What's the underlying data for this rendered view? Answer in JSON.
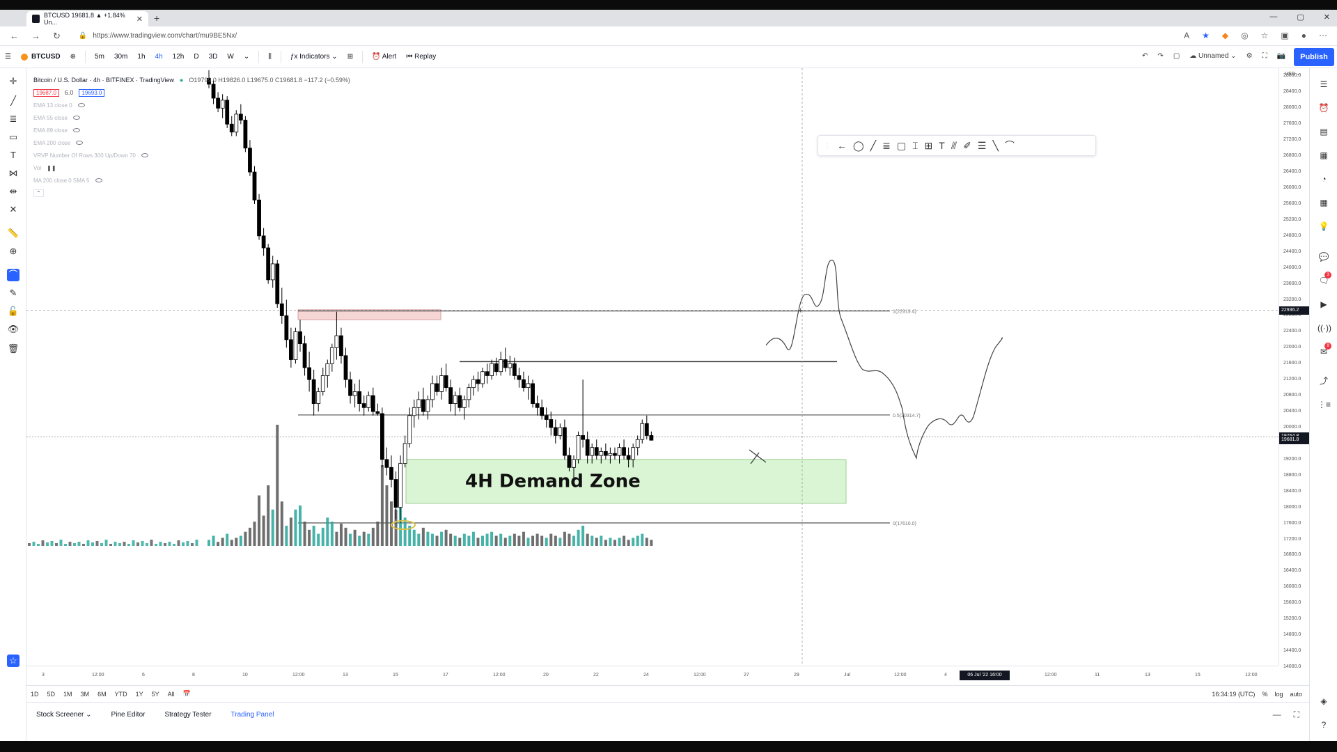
{
  "browser": {
    "tab_title": "BTCUSD 19681.8 ▲ +1.84% Un...",
    "url": "https://www.tradingview.com/chart/mu9BE5Nx/"
  },
  "toolbar": {
    "symbol": "BTCUSD",
    "intervals": [
      "5m",
      "30m",
      "1h",
      "4h",
      "12h",
      "D",
      "3D",
      "W"
    ],
    "indicators_label": "Indicators",
    "alert_label": "Alert",
    "replay_label": "Replay",
    "layout_name": "Unnamed",
    "publish_label": "Publish"
  },
  "legend": {
    "title": "Bitcoin / U.S. Dollar · 4h · BITFINEX · TradingView",
    "ohlc": "O19799.0 H19826.0 L19675.0 C19681.8 −117.2 (−0.59%)",
    "bid": "19687.0",
    "spread": "6.0",
    "ask": "19693.0",
    "indicators": [
      "EMA 13 close 0",
      "EMA 55 close",
      "EMA 89 close",
      "EMA 200 close",
      "VRVP Number Of Rows 300 Up/Down 70",
      "Vol",
      "MA 200 close 0 SMA 5"
    ]
  },
  "chart_data": {
    "type": "candlestick",
    "symbol": "BTCUSD",
    "timeframe": "4h",
    "exchange": "BITFINEX",
    "ylim": [
      14000,
      29000
    ],
    "price_ticks": [
      29000,
      28800,
      28400,
      28000,
      27600,
      27200,
      26800,
      26400,
      26000,
      25600,
      25200,
      24800,
      24400,
      24000,
      23600,
      23200,
      22800,
      22400,
      22000,
      21600,
      21200,
      20800,
      20400,
      20000,
      19600,
      19200,
      18800,
      18400,
      18000,
      17600,
      17200,
      16800,
      16400,
      16000,
      15600,
      15200,
      14800,
      14400,
      14000
    ],
    "time_ticks": [
      "3",
      "12:00",
      "6",
      "8",
      "10",
      "12:00",
      "13",
      "15",
      "17",
      "12:00",
      "20",
      "22",
      "24",
      "12:00",
      "27",
      "29",
      "Jul",
      "12:00",
      "4",
      "8",
      "12:00",
      "11",
      "13",
      "15",
      "12:00"
    ],
    "cursor_time": "06 Jul '22 16:00",
    "cursor_price": "22936.2",
    "last_price": "19681.8",
    "last_price_extra": "19764.8",
    "fib_levels": [
      {
        "label": "1(22919.4)",
        "value": 22919.4
      },
      {
        "label": "0.5(20314.7)",
        "value": 20314.7
      },
      {
        "label": "0(17610.0)",
        "value": 17610.0
      }
    ],
    "annotations": [
      "4H Demand Zone"
    ],
    "demand_zone": [
      18100,
      19200
    ],
    "supply_zone": [
      22700,
      22950
    ],
    "range_high": 21650,
    "colors": {
      "up": "#ffffff",
      "down": "#000000",
      "volume_up": "#26a69a",
      "volume_down": "#555555",
      "zone": "#d9f5d3",
      "supply": "#f6d5d5"
    },
    "candles": [
      [
        28750,
        28950,
        28500,
        28600
      ],
      [
        28600,
        28700,
        28100,
        28250
      ],
      [
        28250,
        28400,
        27900,
        28000
      ],
      [
        28000,
        28350,
        27750,
        28200
      ],
      [
        28200,
        28300,
        27500,
        27600
      ],
      [
        27600,
        27800,
        27300,
        27400
      ],
      [
        27400,
        27950,
        27300,
        27850
      ],
      [
        27850,
        28100,
        27600,
        27700
      ],
      [
        27700,
        27800,
        26900,
        27000
      ],
      [
        27000,
        27200,
        26300,
        26400
      ],
      [
        26400,
        26550,
        25600,
        25700
      ],
      [
        25700,
        25850,
        24700,
        24800
      ],
      [
        24800,
        25000,
        24300,
        24500
      ],
      [
        24500,
        24600,
        23600,
        23700
      ],
      [
        23700,
        24300,
        23500,
        24100
      ],
      [
        24100,
        24200,
        23000,
        23100
      ],
      [
        23100,
        23500,
        22600,
        22800
      ],
      [
        22800,
        23200,
        22000,
        22200
      ],
      [
        22200,
        22500,
        21500,
        21700
      ],
      [
        21700,
        22500,
        21600,
        22400
      ],
      [
        22400,
        22700,
        21900,
        22100
      ],
      [
        22100,
        22300,
        21300,
        21500
      ],
      [
        21500,
        21900,
        20900,
        21200
      ],
      [
        21200,
        21450,
        20300,
        20600
      ],
      [
        20600,
        21000,
        20400,
        20900
      ],
      [
        20900,
        21500,
        20800,
        21300
      ],
      [
        21300,
        21700,
        21000,
        21600
      ],
      [
        21600,
        22100,
        21400,
        22000
      ],
      [
        22000,
        22900,
        21700,
        22300
      ],
      [
        22300,
        22500,
        21600,
        21800
      ],
      [
        21800,
        22000,
        21000,
        21200
      ],
      [
        21200,
        21400,
        20600,
        20800
      ],
      [
        20800,
        21100,
        20500,
        20900
      ],
      [
        20900,
        21200,
        20400,
        20600
      ],
      [
        20600,
        20800,
        20300,
        20500
      ],
      [
        20500,
        20900,
        20400,
        20800
      ],
      [
        20800,
        21000,
        20300,
        20400
      ],
      [
        20400,
        20600,
        20300,
        20350
      ],
      [
        20350,
        20500,
        19000,
        19200
      ],
      [
        19200,
        19500,
        18800,
        19000
      ],
      [
        19000,
        19300,
        18500,
        18700
      ],
      [
        18700,
        18900,
        17700,
        18000
      ],
      [
        18000,
        19300,
        17610,
        19100
      ],
      [
        19100,
        19800,
        19000,
        19600
      ],
      [
        19600,
        20500,
        19500,
        20300
      ],
      [
        20300,
        20700,
        20000,
        20500
      ],
      [
        20500,
        20900,
        20200,
        20700
      ],
      [
        20700,
        21000,
        20300,
        20400
      ],
      [
        20400,
        20800,
        20200,
        20700
      ],
      [
        20700,
        21300,
        20500,
        21100
      ],
      [
        21100,
        21300,
        20800,
        20900
      ],
      [
        20900,
        21500,
        20700,
        21300
      ],
      [
        21300,
        21600,
        20900,
        21000
      ],
      [
        21000,
        21200,
        20400,
        20600
      ],
      [
        20600,
        20900,
        20300,
        20800
      ],
      [
        20800,
        21000,
        20400,
        20500
      ],
      [
        20500,
        20800,
        20200,
        20700
      ],
      [
        20700,
        21100,
        20500,
        21000
      ],
      [
        21000,
        21300,
        20800,
        21200
      ],
      [
        21200,
        21400,
        20900,
        21100
      ],
      [
        21100,
        21500,
        21000,
        21400
      ],
      [
        21400,
        21600,
        21100,
        21300
      ],
      [
        21300,
        21700,
        21200,
        21600
      ],
      [
        21600,
        21750,
        21300,
        21400
      ],
      [
        21400,
        21900,
        21300,
        21700
      ],
      [
        21700,
        22000,
        21400,
        21500
      ],
      [
        21500,
        21800,
        21300,
        21600
      ],
      [
        21600,
        21750,
        21200,
        21300
      ],
      [
        21300,
        21500,
        21000,
        21200
      ],
      [
        21200,
        21400,
        20900,
        21000
      ],
      [
        21000,
        21300,
        20700,
        21100
      ],
      [
        21100,
        21200,
        20500,
        20600
      ],
      [
        20600,
        20800,
        20300,
        20500
      ],
      [
        20500,
        20700,
        20200,
        20300
      ],
      [
        20300,
        20500,
        20000,
        20200
      ],
      [
        20200,
        20400,
        19800,
        20000
      ],
      [
        20000,
        20200,
        19600,
        19800
      ],
      [
        19800,
        20100,
        19700,
        20000
      ],
      [
        20000,
        20200,
        19200,
        19300
      ],
      [
        19300,
        19500,
        18900,
        19000
      ],
      [
        19000,
        19300,
        18700,
        19200
      ],
      [
        19200,
        19900,
        19100,
        19800
      ],
      [
        19800,
        21200,
        19500,
        19700
      ],
      [
        19700,
        19900,
        19100,
        19300
      ],
      [
        19300,
        19600,
        19100,
        19500
      ],
      [
        19500,
        19700,
        19200,
        19300
      ],
      [
        19300,
        19500,
        19100,
        19400
      ],
      [
        19400,
        19600,
        19200,
        19300
      ],
      [
        19300,
        19500,
        19100,
        19350
      ],
      [
        19350,
        19500,
        19200,
        19300
      ],
      [
        19300,
        19600,
        19100,
        19500
      ],
      [
        19500,
        19700,
        19200,
        19300
      ],
      [
        19300,
        19500,
        19000,
        19200
      ],
      [
        19200,
        19600,
        19000,
        19500
      ],
      [
        19500,
        19800,
        19300,
        19700
      ],
      [
        19700,
        20200,
        19600,
        20100
      ],
      [
        20100,
        20300,
        19700,
        19800
      ],
      [
        19800,
        19900,
        19675,
        19682
      ]
    ],
    "volumes": [
      [
        3,
        1
      ],
      [
        5,
        1
      ],
      [
        2,
        0
      ],
      [
        4,
        0
      ],
      [
        6,
        1
      ],
      [
        3,
        0
      ],
      [
        4,
        0
      ],
      [
        5,
        1
      ],
      [
        7,
        0
      ],
      [
        9,
        0
      ],
      [
        12,
        0
      ],
      [
        25,
        0
      ],
      [
        15,
        0
      ],
      [
        30,
        0
      ],
      [
        18,
        1
      ],
      [
        60,
        0
      ],
      [
        22,
        0
      ],
      [
        10,
        1
      ],
      [
        14,
        0
      ],
      [
        18,
        1
      ],
      [
        20,
        1
      ],
      [
        12,
        0
      ],
      [
        8,
        0
      ],
      [
        10,
        1
      ],
      [
        6,
        1
      ],
      [
        9,
        1
      ],
      [
        14,
        1
      ],
      [
        12,
        1
      ],
      [
        7,
        0
      ],
      [
        11,
        0
      ],
      [
        9,
        0
      ],
      [
        6,
        1
      ],
      [
        8,
        0
      ],
      [
        5,
        1
      ],
      [
        7,
        0
      ],
      [
        6,
        1
      ],
      [
        9,
        0
      ],
      [
        12,
        0
      ],
      [
        40,
        0
      ],
      [
        30,
        0
      ],
      [
        22,
        0
      ],
      [
        18,
        0
      ],
      [
        26,
        1
      ],
      [
        14,
        1
      ],
      [
        10,
        1
      ],
      [
        8,
        1
      ],
      [
        6,
        1
      ],
      [
        9,
        0
      ],
      [
        7,
        1
      ],
      [
        6,
        1
      ],
      [
        5,
        0
      ],
      [
        7,
        1
      ],
      [
        8,
        0
      ],
      [
        6,
        0
      ],
      [
        5,
        1
      ],
      [
        4,
        0
      ],
      [
        6,
        1
      ],
      [
        5,
        1
      ],
      [
        7,
        1
      ],
      [
        4,
        0
      ],
      [
        5,
        1
      ],
      [
        6,
        1
      ],
      [
        7,
        1
      ],
      [
        5,
        0
      ],
      [
        6,
        1
      ],
      [
        4,
        0
      ],
      [
        5,
        1
      ],
      [
        6,
        0
      ],
      [
        5,
        0
      ],
      [
        7,
        0
      ],
      [
        4,
        1
      ],
      [
        5,
        0
      ],
      [
        6,
        0
      ],
      [
        5,
        0
      ],
      [
        4,
        1
      ],
      [
        6,
        0
      ],
      [
        5,
        0
      ],
      [
        4,
        1
      ],
      [
        7,
        0
      ],
      [
        6,
        0
      ],
      [
        5,
        1
      ],
      [
        8,
        1
      ],
      [
        10,
        1
      ],
      [
        6,
        0
      ],
      [
        5,
        1
      ],
      [
        4,
        0
      ],
      [
        5,
        1
      ],
      [
        3,
        0
      ],
      [
        4,
        1
      ],
      [
        3,
        0
      ],
      [
        4,
        1
      ],
      [
        5,
        0
      ],
      [
        3,
        0
      ],
      [
        4,
        1
      ],
      [
        5,
        1
      ],
      [
        6,
        1
      ],
      [
        4,
        0
      ],
      [
        3,
        0
      ]
    ]
  },
  "timeaxis": {
    "cursor_label": "06 Jul '22  16:00",
    "ticks": [
      "3",
      "12:00",
      "6",
      "8",
      "10",
      "12:00",
      "13",
      "15",
      "17",
      "12:00",
      "20",
      "22",
      "24",
      "12:00",
      "27",
      "29",
      "Jul",
      "12:00",
      "4",
      "8",
      "12:00",
      "11",
      "13",
      "15",
      "12:00"
    ]
  },
  "rangebar": {
    "ranges": [
      "1D",
      "5D",
      "1M",
      "3M",
      "6M",
      "YTD",
      "1Y",
      "5Y",
      "All"
    ],
    "clock": "16:34:19 (UTC)",
    "percent_label": "%",
    "log_label": "log",
    "auto_label": "auto"
  },
  "bottompanel": {
    "tabs": [
      "Stock Screener",
      "Pine Editor",
      "Strategy Tester",
      "Trading Panel"
    ]
  }
}
